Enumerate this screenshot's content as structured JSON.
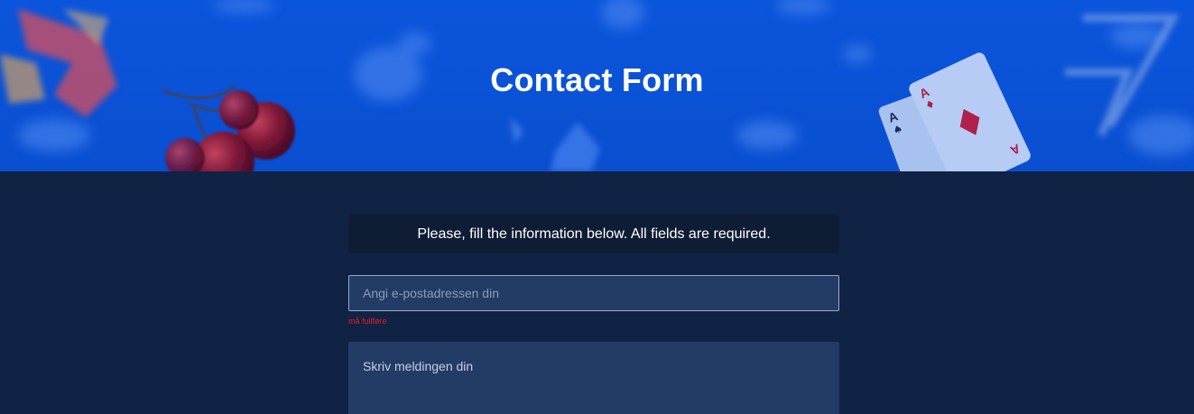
{
  "hero": {
    "title": "Contact Form"
  },
  "form": {
    "notice": "Please, fill the information below. All fields are required.",
    "email": {
      "value": "",
      "placeholder": "Angi e-postadressen din",
      "error": "må fullføre"
    },
    "message": {
      "value": "",
      "placeholder": "Skriv meldingen din"
    }
  },
  "colors": {
    "hero_bg": "#0a52d6",
    "page_bg": "#112344",
    "notice_bg": "#0f1d34",
    "field_bg": "#233c66",
    "error": "#e0201e"
  },
  "decorations": [
    "blurred-lucky-seven",
    "cherries",
    "playing-cards-aces",
    "blurred-card-suits"
  ]
}
